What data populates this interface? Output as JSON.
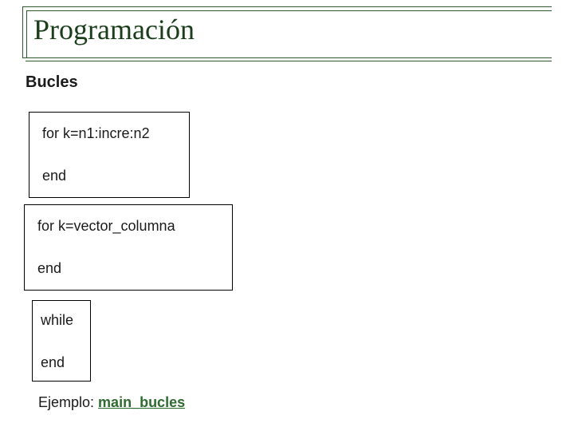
{
  "title": "Programación",
  "subtitle": "Bucles",
  "box1": {
    "line1": "for k=n1:incre:n2",
    "line2": "end"
  },
  "box2": {
    "line1": "for k=vector_columna",
    "line2": "end"
  },
  "box3": {
    "line1": "while",
    "line2": "end"
  },
  "example": {
    "prefix": "Ejemplo: ",
    "link": "main_bucles"
  }
}
